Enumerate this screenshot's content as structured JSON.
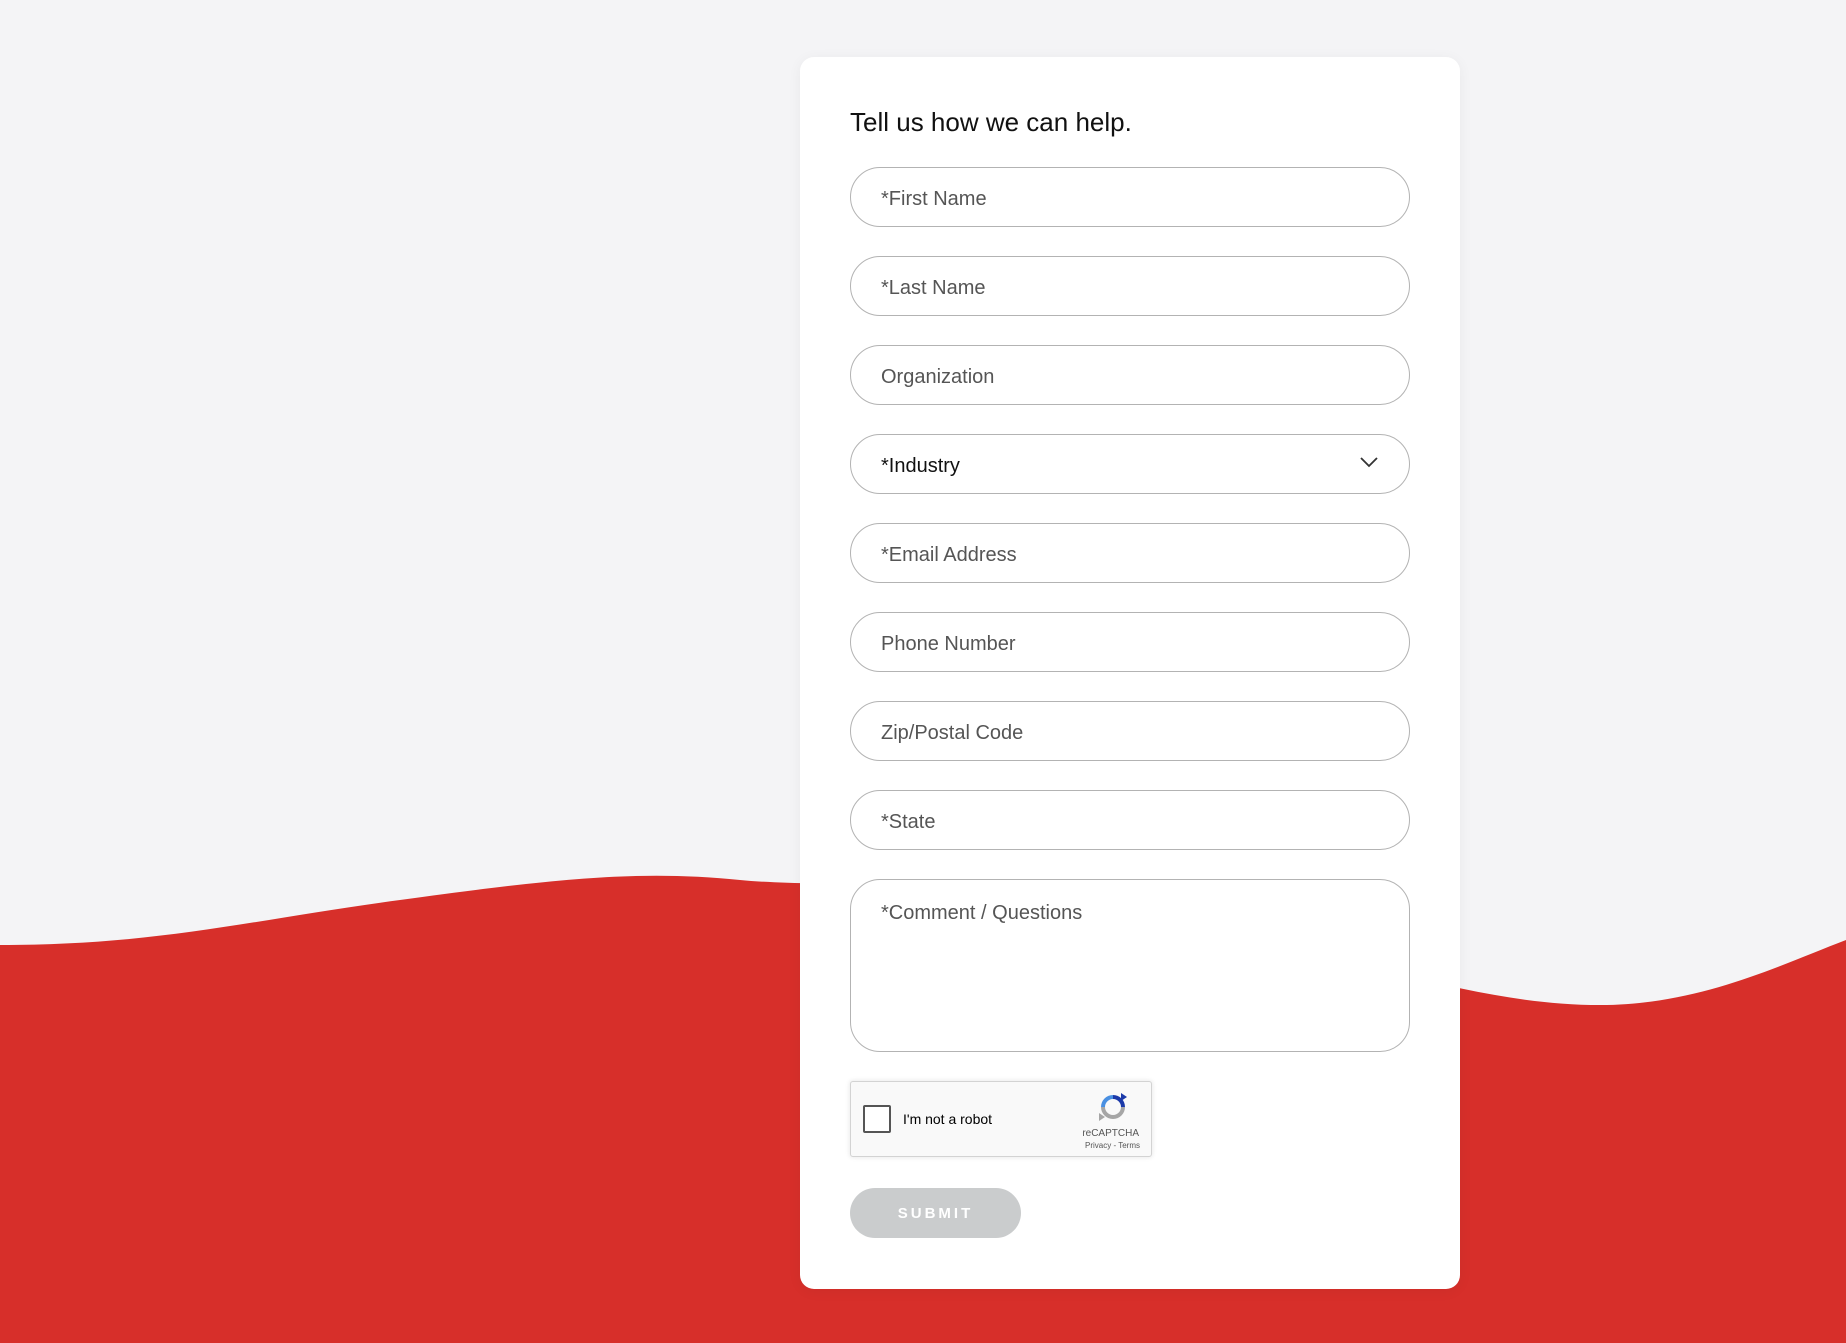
{
  "colors": {
    "page_background": "#f4f4f6",
    "accent_wave": "#d72f2a",
    "card_background": "#ffffff",
    "field_border": "#b3b3b3",
    "submit_disabled": "#cacccd"
  },
  "form": {
    "title": "Tell us how we can help.",
    "first_name": {
      "placeholder": "*First Name",
      "value": ""
    },
    "last_name": {
      "placeholder": "*Last Name",
      "value": ""
    },
    "organization": {
      "placeholder": "Organization",
      "value": ""
    },
    "industry": {
      "selected": "*Industry",
      "icon": "chevron-down-icon"
    },
    "email": {
      "placeholder": "*Email Address",
      "value": ""
    },
    "phone": {
      "placeholder": "Phone Number",
      "value": ""
    },
    "zip": {
      "placeholder": "Zip/Postal Code",
      "value": ""
    },
    "state": {
      "placeholder": "*State",
      "value": ""
    },
    "comment": {
      "placeholder": "*Comment / Questions",
      "value": ""
    },
    "recaptcha": {
      "label": "I'm not a robot",
      "brand": "reCAPTCHA",
      "privacy": "Privacy",
      "separator": " - ",
      "terms": "Terms",
      "icon": "recaptcha-logo-icon"
    },
    "submit_label": "SUBMIT"
  }
}
